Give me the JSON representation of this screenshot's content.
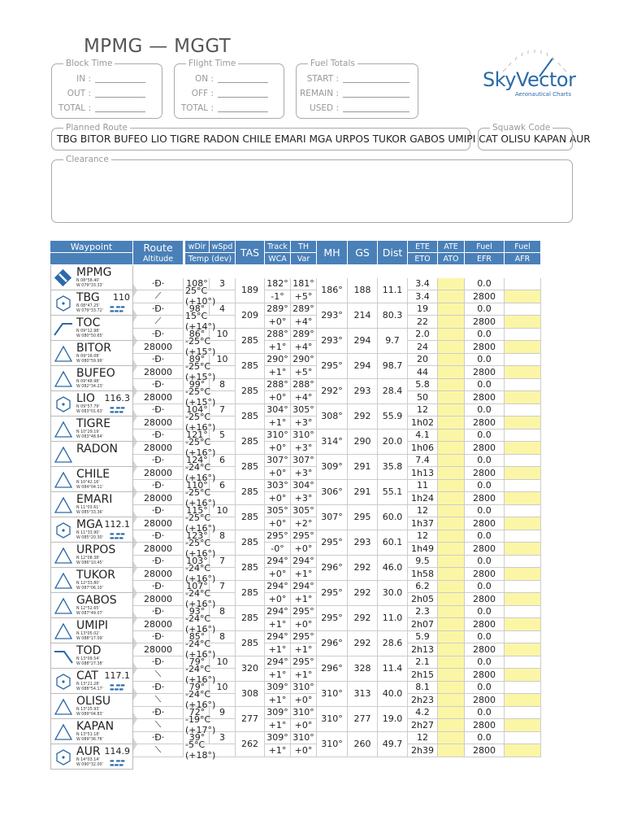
{
  "title": "MPMG — MGGT",
  "block_time": {
    "legend": "Block Time",
    "in_label": "IN :",
    "out_label": "OUT :",
    "total_label": "TOTAL :"
  },
  "flight_time": {
    "legend": "Flight Time",
    "on_label": "ON :",
    "off_label": "OFF :",
    "total_label": "TOTAL :"
  },
  "fuel_totals": {
    "legend": "Fuel Totals",
    "start_label": "START :",
    "remain_label": "REMAIN :",
    "used_label": "USED :"
  },
  "planned_route": {
    "legend": "Planned Route",
    "value": "TBG BITOR BUFEO LIO TIGRE RADON CHILE EMARI MGA URPOS TUKOR GABOS UMIPI CAT OLISU KAPAN AUR"
  },
  "squawk": {
    "legend": "Squawk Code",
    "value": ""
  },
  "clearance": {
    "legend": "Clearance",
    "value": ""
  },
  "logo": {
    "name": "SkyVector",
    "sub": "Aeronautical Charts",
    "color": "#2b6aa9"
  },
  "colors": {
    "header": "#4a80b8",
    "fuel_cell": "#fbf6a6"
  },
  "headers": {
    "waypoint": "Waypoint",
    "route": "Route",
    "altitude": "Altitude",
    "wdir": "wDir",
    "wspd": "wSpd",
    "temp": "Temp (dev)",
    "tas": "TAS",
    "track": "Track",
    "wca": "WCA",
    "th": "TH",
    "var": "Var",
    "mh": "MH",
    "gs": "GS",
    "dist": "Dist",
    "ete": "ETE",
    "eto": "ETO",
    "ate": "ATE",
    "ato": "ATO",
    "fuel": "Fuel",
    "efr": "EFR",
    "fuel2": "Fuel",
    "afr": "AFR"
  },
  "waypoints": [
    {
      "name": "MPMG",
      "freq": "",
      "lat": "N 08°58.40'",
      "lon": "W 079°33.33'",
      "icon": "airport-icon"
    },
    {
      "name": "TBG",
      "freq": "110",
      "lat": "N 08°47.25'",
      "lon": "W 079°33.72'",
      "icon": "vor-icon"
    },
    {
      "name": "TOC",
      "freq": "",
      "lat": "N 09°12.98'",
      "lon": "W 080°50.65'",
      "icon": "climb-icon"
    },
    {
      "name": "BITOR",
      "freq": "",
      "lat": "N 09°16.08'",
      "lon": "W 080°59.99'",
      "icon": "fix-icon"
    },
    {
      "name": "BUFEO",
      "freq": "",
      "lat": "N 09°48.98'",
      "lon": "W 082°34.23'",
      "icon": "fix-icon"
    },
    {
      "name": "LIO",
      "freq": "116.3",
      "lat": "N 09°57.79'",
      "lon": "W 083°01.63'",
      "icon": "vor-icon"
    },
    {
      "name": "TIGRE",
      "freq": "",
      "lat": "N 10°29.19'",
      "lon": "W 083°48.64'",
      "icon": "fix-icon"
    },
    {
      "name": "RADON",
      "freq": "",
      "lat": "",
      "lon": "",
      "icon": "fix-icon"
    },
    {
      "name": "CHILE",
      "freq": "",
      "lat": "N 10°42.16'",
      "lon": "W 084°04.11'",
      "icon": "fix-icon"
    },
    {
      "name": "EMARI",
      "freq": "",
      "lat": "N 11°03.61'",
      "lon": "W 085°33.36'",
      "icon": "fix-icon"
    },
    {
      "name": "MGA",
      "freq": "112.1",
      "lat": "N 11°33.90'",
      "lon": "W 085°20.30'",
      "icon": "vor-icon"
    },
    {
      "name": "URPOS",
      "freq": "",
      "lat": "N 12°08.38'",
      "lon": "W 086°10.45'",
      "icon": "fix-icon"
    },
    {
      "name": "TUKOR",
      "freq": "",
      "lat": "N 12°33.80'",
      "lon": "W 087°06.10'",
      "icon": "fix-icon"
    },
    {
      "name": "GABOS",
      "freq": "",
      "lat": "N 12°52.65'",
      "lon": "W 087°49.07'",
      "icon": "fix-icon"
    },
    {
      "name": "UMIPI",
      "freq": "",
      "lat": "N 13°05.02'",
      "lon": "W 088°17.09'",
      "icon": "fix-icon"
    },
    {
      "name": "TOD",
      "freq": "",
      "lat": "N 13°09.54'",
      "lon": "W 088°27.38'",
      "icon": "descent-icon"
    },
    {
      "name": "CAT",
      "freq": "117.1",
      "lat": "N 13°21.28'",
      "lon": "W 088°54.17'",
      "icon": "vor-icon"
    },
    {
      "name": "OLISU",
      "freq": "",
      "lat": "N 13°25.93'",
      "lon": "W 089°04.83'",
      "icon": "fix-icon"
    },
    {
      "name": "KAPAN",
      "freq": "",
      "lat": "N 13°51.18'",
      "lon": "W 089°36.78'",
      "icon": "fix-icon"
    },
    {
      "name": "AUR",
      "freq": "114.9",
      "lat": "N 14°03.14'",
      "lon": "W 090°32.00'",
      "icon": "vor-icon"
    }
  ],
  "legs": [
    {
      "route": "·Đ·",
      "alt": "",
      "alt_icon": "climb",
      "wdir": "108°",
      "wspd": "3",
      "temp": "25°C (+10°)",
      "tas": "189",
      "track": "182°",
      "wca": "-1°",
      "th": "181°",
      "var": "+5°",
      "mh": "186°",
      "gs": "188",
      "dist": "11.1",
      "ete": "3.4",
      "eto": "3.4",
      "fuel": "0.0",
      "efr": "2800"
    },
    {
      "route": "·Đ·",
      "alt": "",
      "alt_icon": "climb",
      "wdir": "98°",
      "wspd": "4",
      "temp": "15°C (+14°)",
      "tas": "209",
      "track": "289°",
      "wca": "+0°",
      "th": "289°",
      "var": "+4°",
      "mh": "293°",
      "gs": "214",
      "dist": "80.3",
      "ete": "19",
      "eto": "22",
      "fuel": "0.0",
      "efr": "2800"
    },
    {
      "route": "·Đ·",
      "alt": "28000",
      "alt_icon": "",
      "wdir": "86°",
      "wspd": "10",
      "temp": "-25°C (+15°)",
      "tas": "285",
      "track": "288°",
      "wca": "+1°",
      "th": "289°",
      "var": "+4°",
      "mh": "293°",
      "gs": "294",
      "dist": "9.7",
      "ete": "2.0",
      "eto": "24",
      "fuel": "0.0",
      "efr": "2800"
    },
    {
      "route": "·Đ·",
      "alt": "28000",
      "alt_icon": "",
      "wdir": "89°",
      "wspd": "10",
      "temp": "-25°C (+15°)",
      "tas": "285",
      "track": "290°",
      "wca": "+1°",
      "th": "290°",
      "var": "+5°",
      "mh": "295°",
      "gs": "294",
      "dist": "98.7",
      "ete": "20",
      "eto": "44",
      "fuel": "0.0",
      "efr": "2800"
    },
    {
      "route": "·Đ·",
      "alt": "28000",
      "alt_icon": "",
      "wdir": "99°",
      "wspd": "8",
      "temp": "-25°C (+15°)",
      "tas": "285",
      "track": "288°",
      "wca": "+0°",
      "th": "288°",
      "var": "+4°",
      "mh": "292°",
      "gs": "293",
      "dist": "28.4",
      "ete": "5.8",
      "eto": "50",
      "fuel": "0.0",
      "efr": "2800"
    },
    {
      "route": "·Đ·",
      "alt": "28000",
      "alt_icon": "",
      "wdir": "104°",
      "wspd": "7",
      "temp": "-25°C (+16°)",
      "tas": "285",
      "track": "304°",
      "wca": "+1°",
      "th": "305°",
      "var": "+3°",
      "mh": "308°",
      "gs": "292",
      "dist": "55.9",
      "ete": "12",
      "eto": "1h02",
      "fuel": "0.0",
      "efr": "2800"
    },
    {
      "route": "·Đ·",
      "alt": "28000",
      "alt_icon": "",
      "wdir": "121°",
      "wspd": "5",
      "temp": "-25°C (+16°)",
      "tas": "285",
      "track": "310°",
      "wca": "+0°",
      "th": "310°",
      "var": "+3°",
      "mh": "314°",
      "gs": "290",
      "dist": "20.0",
      "ete": "4.1",
      "eto": "1h06",
      "fuel": "0.0",
      "efr": "2800"
    },
    {
      "route": "·Đ·",
      "alt": "28000",
      "alt_icon": "",
      "wdir": "124°",
      "wspd": "6",
      "temp": "-24°C (+16°)",
      "tas": "285",
      "track": "307°",
      "wca": "+0°",
      "th": "307°",
      "var": "+3°",
      "mh": "309°",
      "gs": "291",
      "dist": "35.8",
      "ete": "7.4",
      "eto": "1h13",
      "fuel": "0.0",
      "efr": "2800"
    },
    {
      "route": "·Đ·",
      "alt": "28000",
      "alt_icon": "",
      "wdir": "110°",
      "wspd": "6",
      "temp": "-25°C (+16°)",
      "tas": "285",
      "track": "303°",
      "wca": "+0°",
      "th": "304°",
      "var": "+3°",
      "mh": "306°",
      "gs": "291",
      "dist": "55.1",
      "ete": "11",
      "eto": "1h24",
      "fuel": "0.0",
      "efr": "2800"
    },
    {
      "route": "·Đ·",
      "alt": "28000",
      "alt_icon": "",
      "wdir": "115°",
      "wspd": "10",
      "temp": "-25°C (+16°)",
      "tas": "285",
      "track": "305°",
      "wca": "+0°",
      "th": "305°",
      "var": "+2°",
      "mh": "307°",
      "gs": "295",
      "dist": "60.0",
      "ete": "12",
      "eto": "1h37",
      "fuel": "0.0",
      "efr": "2800"
    },
    {
      "route": "·Đ·",
      "alt": "28000",
      "alt_icon": "",
      "wdir": "123°",
      "wspd": "8",
      "temp": "-25°C (+16°)",
      "tas": "285",
      "track": "295°",
      "wca": "-0°",
      "th": "295°",
      "var": "+0°",
      "mh": "295°",
      "gs": "293",
      "dist": "60.1",
      "ete": "12",
      "eto": "1h49",
      "fuel": "0.0",
      "efr": "2800"
    },
    {
      "route": "·Đ·",
      "alt": "28000",
      "alt_icon": "",
      "wdir": "103°",
      "wspd": "7",
      "temp": "-24°C (+16°)",
      "tas": "285",
      "track": "294°",
      "wca": "+0°",
      "th": "294°",
      "var": "+1°",
      "mh": "296°",
      "gs": "292",
      "dist": "46.0",
      "ete": "9.5",
      "eto": "1h58",
      "fuel": "0.0",
      "efr": "2800"
    },
    {
      "route": "·Đ·",
      "alt": "28000",
      "alt_icon": "",
      "wdir": "107°",
      "wspd": "7",
      "temp": "-24°C (+16°)",
      "tas": "285",
      "track": "294°",
      "wca": "+0°",
      "th": "294°",
      "var": "+1°",
      "mh": "295°",
      "gs": "292",
      "dist": "30.0",
      "ete": "6.2",
      "eto": "2h05",
      "fuel": "0.0",
      "efr": "2800"
    },
    {
      "route": "·Đ·",
      "alt": "28000",
      "alt_icon": "",
      "wdir": "93°",
      "wspd": "8",
      "temp": "-24°C (+16°)",
      "tas": "285",
      "track": "294°",
      "wca": "+1°",
      "th": "295°",
      "var": "+0°",
      "mh": "295°",
      "gs": "292",
      "dist": "11.0",
      "ete": "2.3",
      "eto": "2h07",
      "fuel": "0.0",
      "efr": "2800"
    },
    {
      "route": "·Đ·",
      "alt": "28000",
      "alt_icon": "",
      "wdir": "85°",
      "wspd": "8",
      "temp": "-24°C (+16°)",
      "tas": "285",
      "track": "294°",
      "wca": "+1°",
      "th": "295°",
      "var": "+1°",
      "mh": "296°",
      "gs": "292",
      "dist": "28.6",
      "ete": "5.9",
      "eto": "2h13",
      "fuel": "0.0",
      "efr": "2800"
    },
    {
      "route": "·Đ·",
      "alt": "",
      "alt_icon": "descent",
      "wdir": "79°",
      "wspd": "10",
      "temp": "-24°C (+16°)",
      "tas": "320",
      "track": "294°",
      "wca": "+1°",
      "th": "295°",
      "var": "+1°",
      "mh": "296°",
      "gs": "328",
      "dist": "11.4",
      "ete": "2.1",
      "eto": "2h15",
      "fuel": "0.0",
      "efr": "2800"
    },
    {
      "route": "·Đ·",
      "alt": "",
      "alt_icon": "descent",
      "wdir": "79°",
      "wspd": "10",
      "temp": "-24°C (+16°)",
      "tas": "308",
      "track": "309°",
      "wca": "+1°",
      "th": "310°",
      "var": "+0°",
      "mh": "310°",
      "gs": "313",
      "dist": "40.0",
      "ete": "8.1",
      "eto": "2h23",
      "fuel": "0.0",
      "efr": "2800"
    },
    {
      "route": "·Đ·",
      "alt": "",
      "alt_icon": "descent",
      "wdir": "72°",
      "wspd": "9",
      "temp": "-19°C (+17°)",
      "tas": "277",
      "track": "309°",
      "wca": "+1°",
      "th": "310°",
      "var": "+0°",
      "mh": "310°",
      "gs": "277",
      "dist": "19.0",
      "ete": "4.2",
      "eto": "2h27",
      "fuel": "0.0",
      "efr": "2800"
    },
    {
      "route": "·Đ·",
      "alt": "",
      "alt_icon": "descent",
      "wdir": "39°",
      "wspd": "3",
      "temp": "-5°C (+18°)",
      "tas": "262",
      "track": "309°",
      "wca": "+1°",
      "th": "310°",
      "var": "+0°",
      "mh": "310°",
      "gs": "260",
      "dist": "49.7",
      "ete": "12",
      "eto": "2h39",
      "fuel": "0.0",
      "efr": "2800"
    }
  ]
}
